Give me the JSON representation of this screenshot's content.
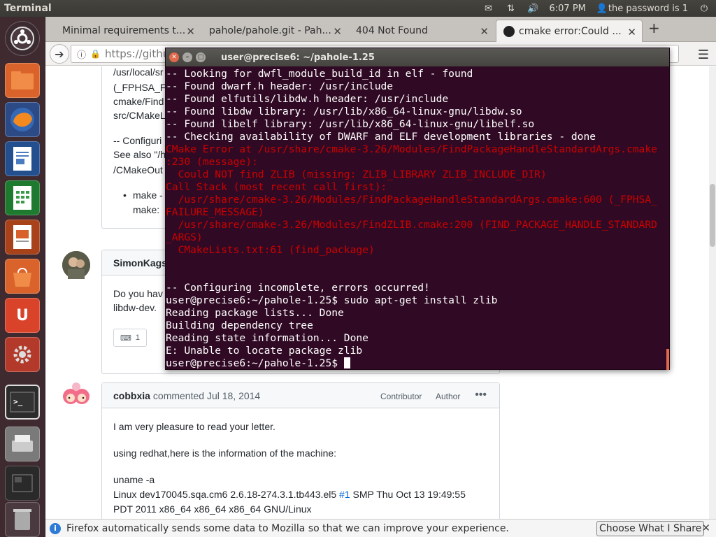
{
  "top_panel": {
    "app_title": "Terminal",
    "time": "6:07 PM",
    "user": "the password is 1",
    "icons": [
      "mail-icon",
      "network-icon",
      "volume-icon",
      "user-icon",
      "power-icon"
    ]
  },
  "launcher": {
    "items": [
      "dash-icon",
      "files-icon",
      "firefox-icon",
      "writer-icon",
      "calc-icon",
      "impress-icon",
      "software-center-icon",
      "ubuntu-one-icon",
      "settings-icon",
      "terminal-icon",
      "scanner-icon",
      "workspaces-icon",
      "trash-icon"
    ]
  },
  "browser": {
    "tabs": [
      {
        "label": "Minimal requirements t..."
      },
      {
        "label": "pahole/pahole.git - Pah..."
      },
      {
        "label": "404 Not Found"
      },
      {
        "label": "cmake error:Could ..."
      }
    ],
    "url": "https://githu",
    "notification": {
      "text": "Firefox automatically sends some data to Mozilla so that we can improve your experience.",
      "button": "Choose What I Share"
    }
  },
  "page": {
    "box1_lines": [
      "/usr/local/sr",
      "(_FPHSA_F",
      "cmake/Find",
      "src/CMakeL",
      "-- Configuri",
      "See also \"/h",
      "/CMakeOut",
      "make -",
      "make: "
    ],
    "comment2": {
      "author": "SimonKags",
      "body_line1": "Do you hav",
      "body_line2": "libdw-dev.",
      "reaction_count": "1"
    },
    "comment3": {
      "author": "cobbxia",
      "meta": "commented Jul 18, 2014",
      "label_contributor": "Contributor",
      "label_author": "Author",
      "para1": "I am very pleasure to read your letter.",
      "para2": "using redhat,here is the information of the machine:",
      "para3": "uname -a",
      "para4_pre": "Linux dev170045.sqa.cm6 2.6.18-274.3.1.tb443.el5 ",
      "para4_link": "#1",
      "para4_post": " SMP Thu Oct 13 19:49:55",
      "para5": "PDT 2011 x86_64 x86_64 x86_64 GNU/Linux"
    }
  },
  "terminal": {
    "title": "user@precise6: ~/pahole-1.25",
    "lines": [
      {
        "text": "-- Looking for dwfl_module_build_id in elf - found",
        "err": false
      },
      {
        "text": "-- Found dwarf.h header: /usr/include",
        "err": false
      },
      {
        "text": "-- Found elfutils/libdw.h header: /usr/include",
        "err": false
      },
      {
        "text": "-- Found libdw library: /usr/lib/x86_64-linux-gnu/libdw.so",
        "err": false
      },
      {
        "text": "-- Found libelf library: /usr/lib/x86_64-linux-gnu/libelf.so",
        "err": false
      },
      {
        "text": "-- Checking availability of DWARF and ELF development libraries - done",
        "err": false
      },
      {
        "text": "CMake Error at /usr/share/cmake-3.26/Modules/FindPackageHandleStandardArgs.cmake",
        "err": true
      },
      {
        "text": ":230 (message):",
        "err": true
      },
      {
        "text": "  Could NOT find ZLIB (missing: ZLIB_LIBRARY ZLIB_INCLUDE_DIR)",
        "err": true
      },
      {
        "text": "Call Stack (most recent call first):",
        "err": true
      },
      {
        "text": "  /usr/share/cmake-3.26/Modules/FindPackageHandleStandardArgs.cmake:600 (_FPHSA_",
        "err": true
      },
      {
        "text": "FAILURE_MESSAGE)",
        "err": true
      },
      {
        "text": "  /usr/share/cmake-3.26/Modules/FindZLIB.cmake:200 (FIND_PACKAGE_HANDLE_STANDARD",
        "err": true
      },
      {
        "text": "_ARGS)",
        "err": true
      },
      {
        "text": "  CMakeLists.txt:61 (find_package)",
        "err": true
      },
      {
        "text": "",
        "err": false
      },
      {
        "text": "",
        "err": false
      },
      {
        "text": "-- Configuring incomplete, errors occurred!",
        "err": false
      },
      {
        "text": "user@precise6:~/pahole-1.25$ sudo apt-get install zlib",
        "err": false
      },
      {
        "text": "Reading package lists... Done",
        "err": false
      },
      {
        "text": "Building dependency tree",
        "err": false
      },
      {
        "text": "Reading state information... Done",
        "err": false
      },
      {
        "text": "E: Unable to locate package zlib",
        "err": false
      }
    ],
    "prompt": "user@precise6:~/pahole-1.25$ "
  },
  "colors": {
    "terminal_bg": "#300a24",
    "error_red": "#cc0000",
    "launcher_bg": "#3f2a30",
    "ubuntu_orange": "#e95420"
  }
}
